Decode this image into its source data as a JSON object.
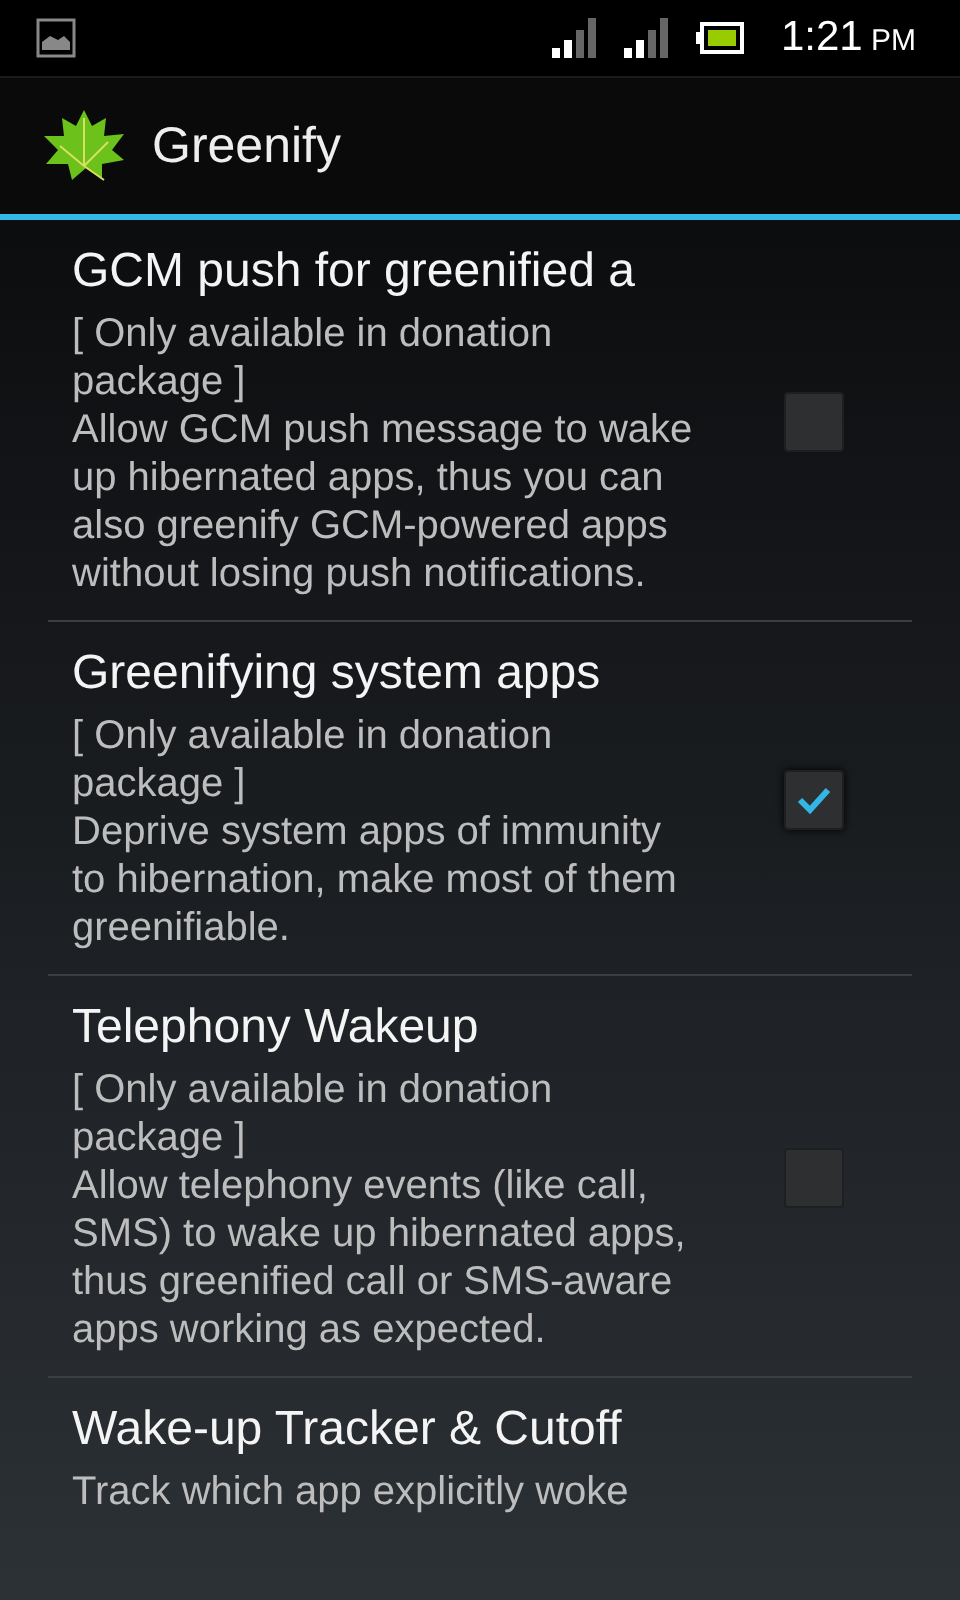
{
  "status_bar": {
    "time": "1:21",
    "meridiem": "PM"
  },
  "action_bar": {
    "title": "Greenify"
  },
  "preferences": [
    {
      "title": "GCM push for greenified a",
      "note": "[ Only available in donation package ]",
      "summary": "Allow GCM push message to wake up hibernated apps, thus you can also greenify GCM-powered apps without losing push notifications.",
      "checked": false
    },
    {
      "title": "Greenifying system apps",
      "note": "[ Only available in donation package ]",
      "summary": "Deprive system apps of immunity to hibernation, make most of them greenifiable.",
      "checked": true
    },
    {
      "title": "Telephony Wakeup",
      "note": "[ Only available in donation package ]",
      "summary": "Allow telephony events (like call, SMS) to wake up hibernated apps, thus greenified call or SMS-aware apps working as expected.",
      "checked": false
    },
    {
      "title": "Wake-up Tracker & Cutoff",
      "summary": "Track which app explicitly woke"
    }
  ]
}
